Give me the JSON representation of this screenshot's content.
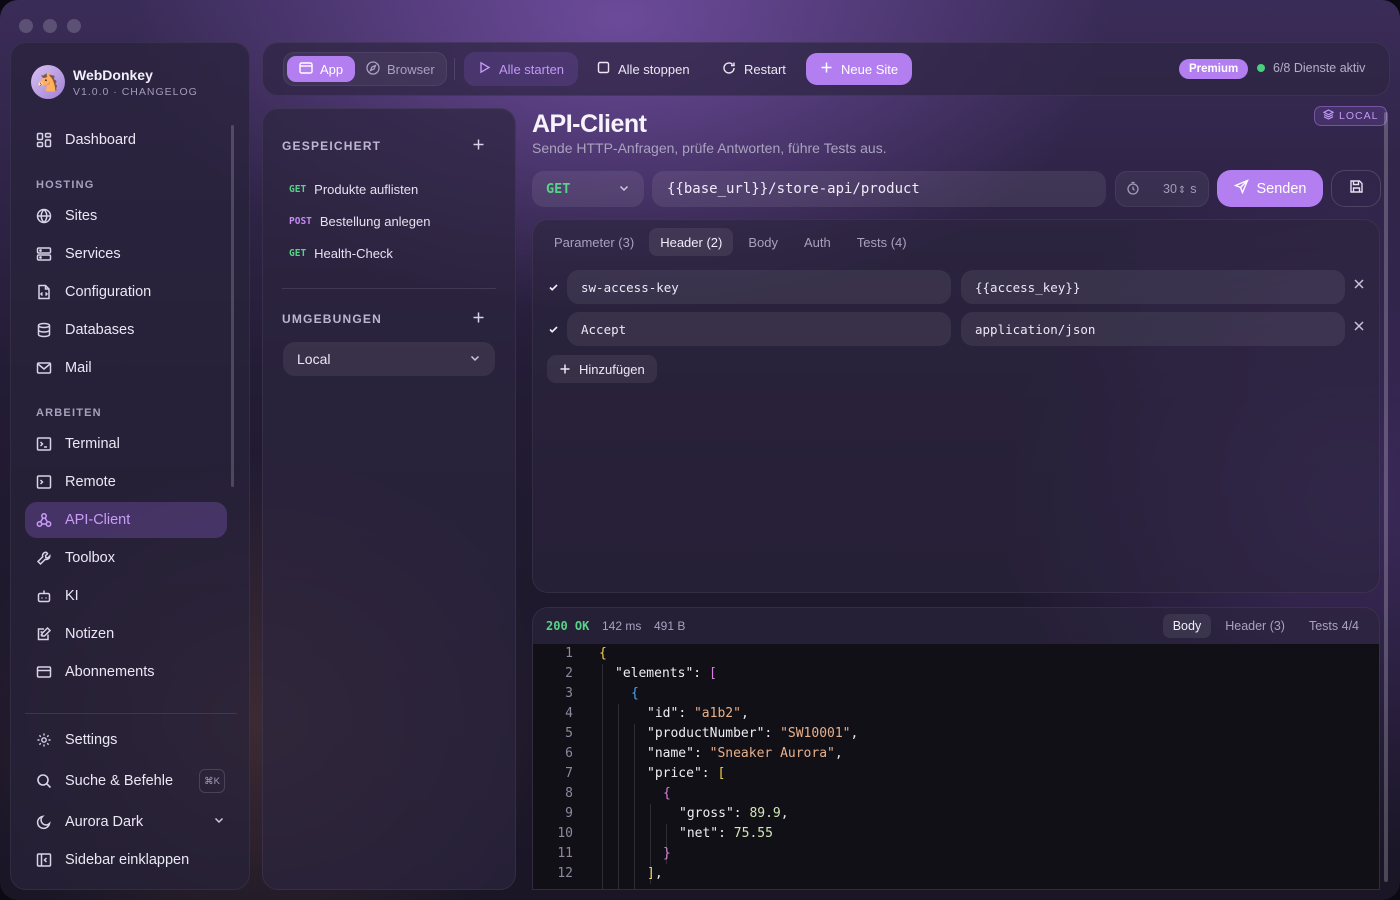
{
  "app": {
    "name": "WebDonkey",
    "version": "V1.0.0 · CHANGELOG",
    "logo_icon": "donkey-logo"
  },
  "sidebar": {
    "top": [
      {
        "label": "Dashboard",
        "icon": "dashboard-icon"
      }
    ],
    "hosting_title": "HOSTING",
    "hosting": [
      {
        "label": "Sites",
        "icon": "globe-icon"
      },
      {
        "label": "Services",
        "icon": "server-icon"
      },
      {
        "label": "Configuration",
        "icon": "file-code-icon"
      },
      {
        "label": "Databases",
        "icon": "database-icon"
      },
      {
        "label": "Mail",
        "icon": "mail-icon"
      }
    ],
    "arbeiten_title": "ARBEITEN",
    "arbeiten": [
      {
        "label": "Terminal",
        "icon": "terminal-icon"
      },
      {
        "label": "Remote",
        "icon": "remote-terminal-icon"
      },
      {
        "label": "API-Client",
        "icon": "webhook-icon",
        "active": true
      },
      {
        "label": "Toolbox",
        "icon": "wrench-icon"
      },
      {
        "label": "KI",
        "icon": "bot-icon"
      },
      {
        "label": "Notizen",
        "icon": "note-edit-icon"
      },
      {
        "label": "Abonnements",
        "icon": "credit-card-icon"
      }
    ],
    "bottom": {
      "settings": "Settings",
      "search": "Suche & Befehle",
      "search_shortcut": "⌘K",
      "theme": "Aurora Dark",
      "collapse": "Sidebar einklappen"
    }
  },
  "toolbar": {
    "app": "App",
    "browser": "Browser",
    "start_all": "Alle starten",
    "stop_all": "Alle stoppen",
    "restart": "Restart",
    "new_site": "Neue Site",
    "premium": "Premium",
    "services_status": "6/8 Dienste aktiv"
  },
  "saved": {
    "title": "GESPEICHERT",
    "requests": [
      {
        "method": "GET",
        "name": "Produkte auflisten"
      },
      {
        "method": "POST",
        "name": "Bestellung anlegen"
      },
      {
        "method": "GET",
        "name": "Health-Check"
      }
    ],
    "env_title": "UMGEBUNGEN",
    "env_selected": "Local"
  },
  "page": {
    "title": "API-Client",
    "subtitle": "Sende HTTP-Anfragen, prüfe Antworten, führe Tests aus.",
    "env_badge": "LOCAL"
  },
  "request": {
    "method": "GET",
    "url": "{{base_url}}/store-api/product",
    "timeout": "30",
    "timeout_unit": "s",
    "send": "Senden",
    "tabs": [
      "Parameter (3)",
      "Header (2)",
      "Body",
      "Auth",
      "Tests (4)"
    ],
    "active_tab": 1,
    "headers": [
      {
        "key": "sw-access-key",
        "value": "{{access_key}}",
        "enabled": true
      },
      {
        "key": "Accept",
        "value": "application/json",
        "enabled": true
      }
    ],
    "add": "Hinzufügen"
  },
  "response": {
    "status": "200 OK",
    "time": "142 ms",
    "size": "491 B",
    "tabs": [
      "Body",
      "Header (3)",
      "Tests 4/4"
    ],
    "active_tab": 0,
    "lines": [
      {
        "n": "1",
        "ind": 0,
        "parts": [
          [
            "b1",
            "{"
          ]
        ]
      },
      {
        "n": "2",
        "ind": 1,
        "parts": [
          [
            "k",
            "\"elements\""
          ],
          [
            "p",
            ": "
          ],
          [
            "b2",
            "["
          ]
        ]
      },
      {
        "n": "3",
        "ind": 2,
        "parts": [
          [
            "b3",
            "{"
          ]
        ]
      },
      {
        "n": "4",
        "ind": 3,
        "parts": [
          [
            "k",
            "\"id\""
          ],
          [
            "p",
            ": "
          ],
          [
            "s",
            "\"a1b2\""
          ],
          [
            "p",
            ","
          ]
        ]
      },
      {
        "n": "5",
        "ind": 3,
        "parts": [
          [
            "k",
            "\"productNumber\""
          ],
          [
            "p",
            ": "
          ],
          [
            "s",
            "\"SW10001\""
          ],
          [
            "p",
            ","
          ]
        ]
      },
      {
        "n": "6",
        "ind": 3,
        "parts": [
          [
            "k",
            "\"name\""
          ],
          [
            "p",
            ": "
          ],
          [
            "s",
            "\"Sneaker Aurora\""
          ],
          [
            "p",
            ","
          ]
        ]
      },
      {
        "n": "7",
        "ind": 3,
        "parts": [
          [
            "k",
            "\"price\""
          ],
          [
            "p",
            ": "
          ],
          [
            "b1",
            "["
          ]
        ]
      },
      {
        "n": "8",
        "ind": 4,
        "parts": [
          [
            "b2",
            "{"
          ]
        ]
      },
      {
        "n": "9",
        "ind": 5,
        "parts": [
          [
            "k",
            "\"gross\""
          ],
          [
            "p",
            ": "
          ],
          [
            "n",
            "89.9"
          ],
          [
            "p",
            ","
          ]
        ]
      },
      {
        "n": "10",
        "ind": 5,
        "parts": [
          [
            "k",
            "\"net\""
          ],
          [
            "p",
            ": "
          ],
          [
            "n",
            "75.55"
          ]
        ]
      },
      {
        "n": "11",
        "ind": 4,
        "parts": [
          [
            "b2",
            "}"
          ]
        ]
      },
      {
        "n": "12",
        "ind": 3,
        "parts": [
          [
            "b1",
            "]"
          ],
          [
            "p",
            ","
          ]
        ]
      }
    ]
  }
}
